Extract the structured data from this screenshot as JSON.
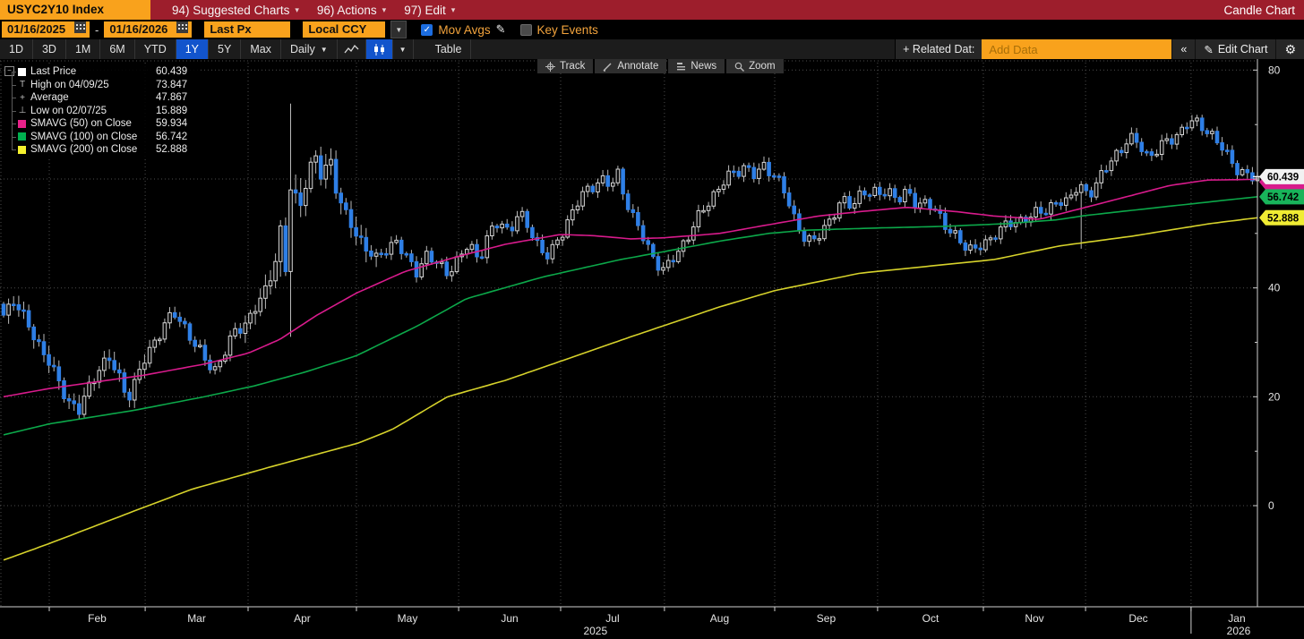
{
  "titlebar": {
    "ticker": "USYC2Y10 Index",
    "menus": [
      {
        "label": "94) Suggested Charts"
      },
      {
        "label": "96) Actions"
      },
      {
        "label": "97) Edit"
      }
    ],
    "right_title": "Candle Chart"
  },
  "controls": {
    "date_from": "01/16/2025",
    "date_sep": "-",
    "date_to": "01/16/2026",
    "price_field": "Last Px",
    "currency": "Local CCY",
    "mov_avgs_label": "Mov Avgs",
    "mov_avgs_checked": true,
    "key_events_label": "Key Events",
    "key_events_checked": false
  },
  "toolbar": {
    "ranges": [
      "1D",
      "3D",
      "1M",
      "6M",
      "YTD",
      "1Y",
      "5Y",
      "Max"
    ],
    "active_range": "1Y",
    "period": "Daily",
    "table_label": "Table",
    "related_data_label": "+ Related Dat:",
    "add_data_placeholder": "Add Data",
    "collapse_label": "«",
    "edit_chart_label": "Edit Chart"
  },
  "chart_tools": [
    "Track",
    "Annotate",
    "News",
    "Zoom"
  ],
  "legend": {
    "rows": [
      {
        "type": "candle",
        "label": "Last Price",
        "value": "60.439"
      },
      {
        "type": "high",
        "label": "High on 04/09/25",
        "value": "73.847"
      },
      {
        "type": "avg",
        "label": "Average",
        "value": "47.867"
      },
      {
        "type": "low",
        "label": "Low on 02/07/25",
        "value": "15.889"
      },
      {
        "type": "swatch",
        "color": "#e8218a",
        "label": "SMAVG (50) on Close",
        "value": "59.934"
      },
      {
        "type": "swatch",
        "color": "#00b04f",
        "label": "SMAVG (100) on Close",
        "value": "56.742"
      },
      {
        "type": "swatch",
        "color": "#f5f12e",
        "label": "SMAVG (200) on Close",
        "value": "52.888"
      }
    ]
  },
  "chart_data": {
    "type": "candlestick",
    "instrument": "USYC2Y10 Index",
    "date_range": [
      "01/16/2025",
      "01/16/2026"
    ],
    "last_price": 60.439,
    "average": 47.867,
    "high_marker": {
      "date": "04/09/25",
      "value": 73.847
    },
    "low_marker": {
      "date": "02/07/25",
      "value": 15.889
    },
    "y_axis": {
      "ticks": [
        0,
        20,
        40,
        60,
        80
      ],
      "minor_ticks": [
        10,
        30,
        50,
        70
      ]
    },
    "x_axis": {
      "month_labels": [
        "Feb",
        "Mar",
        "Apr",
        "May",
        "Jun",
        "Jul",
        "Aug",
        "Sep",
        "Oct",
        "Nov",
        "Dec",
        "Jan"
      ],
      "month_fracs": [
        0.0364,
        0.1129,
        0.195,
        0.2814,
        0.3629,
        0.4443,
        0.5271,
        0.615,
        0.6971,
        0.7814,
        0.8629,
        0.9471
      ],
      "year_labels": [
        {
          "label": "2025",
          "frac": 0.472
        },
        {
          "label": "2026",
          "frac": 0.985
        }
      ],
      "year_divider_frac": 0.9471
    },
    "num_candles": 250,
    "first_open": 37,
    "colors": {
      "up": "#d6d6d6",
      "down": "#2e7fe6",
      "wick": "#b9b9b9"
    },
    "smavg": [
      {
        "period": 50,
        "value": 59.934,
        "color": "#d81b8c",
        "points": [
          [
            0,
            20
          ],
          [
            0.036,
            21.5
          ],
          [
            0.113,
            24
          ],
          [
            0.16,
            26
          ],
          [
            0.195,
            28
          ],
          [
            0.22,
            30.5
          ],
          [
            0.25,
            35
          ],
          [
            0.281,
            39
          ],
          [
            0.32,
            43
          ],
          [
            0.363,
            45.8
          ],
          [
            0.4,
            48
          ],
          [
            0.444,
            49.8
          ],
          [
            0.47,
            49.6
          ],
          [
            0.5,
            49
          ],
          [
            0.527,
            49.2
          ],
          [
            0.571,
            50
          ],
          [
            0.615,
            51.8
          ],
          [
            0.65,
            53.2
          ],
          [
            0.683,
            54
          ],
          [
            0.72,
            54.8
          ],
          [
            0.76,
            54
          ],
          [
            0.79,
            53.2
          ],
          [
            0.826,
            52.6
          ],
          [
            0.863,
            54.8
          ],
          [
            0.9,
            57
          ],
          [
            0.93,
            58.8
          ],
          [
            0.96,
            59.8
          ],
          [
            1,
            59.934
          ]
        ]
      },
      {
        "period": 100,
        "value": 56.742,
        "color": "#0ca84a",
        "points": [
          [
            0,
            13
          ],
          [
            0.036,
            15
          ],
          [
            0.104,
            17.5
          ],
          [
            0.16,
            20
          ],
          [
            0.2,
            22
          ],
          [
            0.24,
            24.5
          ],
          [
            0.281,
            27.5
          ],
          [
            0.33,
            33
          ],
          [
            0.369,
            38
          ],
          [
            0.43,
            42
          ],
          [
            0.492,
            45.2
          ],
          [
            0.53,
            46.8
          ],
          [
            0.569,
            48.5
          ],
          [
            0.61,
            50
          ],
          [
            0.64,
            50.6
          ],
          [
            0.697,
            51
          ],
          [
            0.75,
            51.3
          ],
          [
            0.8,
            51.8
          ],
          [
            0.84,
            52.5
          ],
          [
            0.863,
            53.3
          ],
          [
            0.91,
            54.5
          ],
          [
            0.95,
            55.5
          ],
          [
            1,
            56.742
          ]
        ]
      },
      {
        "period": 200,
        "value": 52.888,
        "color": "#d6d22b",
        "points": [
          [
            0,
            -10
          ],
          [
            0.036,
            -7
          ],
          [
            0.104,
            -1
          ],
          [
            0.15,
            3
          ],
          [
            0.211,
            7
          ],
          [
            0.283,
            11.5
          ],
          [
            0.31,
            14
          ],
          [
            0.354,
            20
          ],
          [
            0.4,
            23
          ],
          [
            0.444,
            26.5
          ],
          [
            0.5,
            31
          ],
          [
            0.571,
            36.5
          ],
          [
            0.615,
            39.5
          ],
          [
            0.683,
            42.7
          ],
          [
            0.79,
            45.2
          ],
          [
            0.842,
            47.7
          ],
          [
            0.9,
            49.5
          ],
          [
            0.962,
            51.8
          ],
          [
            1,
            52.888
          ]
        ]
      }
    ],
    "close_path": [
      [
        0,
        35
      ],
      [
        0.008,
        37.5
      ],
      [
        0.016,
        34
      ],
      [
        0.024,
        31
      ],
      [
        0.036,
        27
      ],
      [
        0.044,
        23
      ],
      [
        0.052,
        19.5
      ],
      [
        0.0602,
        17.2
      ],
      [
        0.068,
        21
      ],
      [
        0.076,
        25
      ],
      [
        0.084,
        27
      ],
      [
        0.092,
        24
      ],
      [
        0.099,
        20.5
      ],
      [
        0.107,
        24
      ],
      [
        0.113,
        27
      ],
      [
        0.121,
        30
      ],
      [
        0.129,
        33
      ],
      [
        0.137,
        35
      ],
      [
        0.145,
        33
      ],
      [
        0.153,
        30
      ],
      [
        0.161,
        27
      ],
      [
        0.169,
        25
      ],
      [
        0.177,
        28
      ],
      [
        0.185,
        31.5
      ],
      [
        0.195,
        34
      ],
      [
        0.202,
        37
      ],
      [
        0.209,
        40
      ],
      [
        0.216,
        45
      ],
      [
        0.222,
        52
      ],
      [
        0.2263,
        43
      ],
      [
        0.2302,
        58
      ],
      [
        0.236,
        54
      ],
      [
        0.242,
        60
      ],
      [
        0.248,
        64
      ],
      [
        0.254,
        60
      ],
      [
        0.26,
        65
      ],
      [
        0.266,
        58
      ],
      [
        0.272,
        54
      ],
      [
        0.281,
        50
      ],
      [
        0.289,
        47
      ],
      [
        0.297,
        44.5
      ],
      [
        0.305,
        47
      ],
      [
        0.313,
        49
      ],
      [
        0.321,
        46
      ],
      [
        0.329,
        43.5
      ],
      [
        0.337,
        46
      ],
      [
        0.345,
        44
      ],
      [
        0.354,
        42.5
      ],
      [
        0.363,
        45
      ],
      [
        0.371,
        48.5
      ],
      [
        0.379,
        46
      ],
      [
        0.387,
        50
      ],
      [
        0.395,
        52
      ],
      [
        0.403,
        50
      ],
      [
        0.411,
        53
      ],
      [
        0.419,
        51
      ],
      [
        0.427,
        48
      ],
      [
        0.435,
        46
      ],
      [
        0.444,
        50
      ],
      [
        0.452,
        53
      ],
      [
        0.46,
        56
      ],
      [
        0.468,
        58
      ],
      [
        0.476,
        60
      ],
      [
        0.484,
        59
      ],
      [
        0.49,
        61.5
      ],
      [
        0.496,
        57
      ],
      [
        0.502,
        53
      ],
      [
        0.508,
        50
      ],
      [
        0.514,
        47
      ],
      [
        0.52,
        44.5
      ],
      [
        0.527,
        42.5
      ],
      [
        0.535,
        46
      ],
      [
        0.543,
        49
      ],
      [
        0.551,
        52
      ],
      [
        0.559,
        55
      ],
      [
        0.567,
        57
      ],
      [
        0.575,
        59
      ],
      [
        0.583,
        61
      ],
      [
        0.591,
        62.5
      ],
      [
        0.599,
        61
      ],
      [
        0.607,
        63
      ],
      [
        0.615,
        61
      ],
      [
        0.623,
        57
      ],
      [
        0.631,
        52
      ],
      [
        0.639,
        49
      ],
      [
        0.645,
        48
      ],
      [
        0.653,
        51
      ],
      [
        0.661,
        54
      ],
      [
        0.669,
        56
      ],
      [
        0.677,
        55
      ],
      [
        0.685,
        57.5
      ],
      [
        0.691,
        56.5
      ],
      [
        0.697,
        57
      ],
      [
        0.705,
        58.5
      ],
      [
        0.713,
        56.5
      ],
      [
        0.721,
        58
      ],
      [
        0.729,
        55.5
      ],
      [
        0.737,
        55
      ],
      [
        0.745,
        53
      ],
      [
        0.753,
        51
      ],
      [
        0.761,
        49
      ],
      [
        0.769,
        47.5
      ],
      [
        0.777,
        48.5
      ],
      [
        0.785,
        47.8
      ],
      [
        0.793,
        50
      ],
      [
        0.801,
        52
      ],
      [
        0.809,
        51
      ],
      [
        0.817,
        53.5
      ],
      [
        0.825,
        55
      ],
      [
        0.833,
        54
      ],
      [
        0.841,
        56.5
      ],
      [
        0.849,
        55.5
      ],
      [
        0.857,
        58
      ],
      [
        0.865,
        57
      ],
      [
        0.873,
        60
      ],
      [
        0.881,
        63
      ],
      [
        0.889,
        65.5
      ],
      [
        0.897,
        67.5
      ],
      [
        0.905,
        66
      ],
      [
        0.913,
        63.5
      ],
      [
        0.921,
        65.5
      ],
      [
        0.929,
        67
      ],
      [
        0.937,
        69
      ],
      [
        0.945,
        71
      ],
      [
        0.953,
        70
      ],
      [
        0.961,
        68.5
      ],
      [
        0.969,
        66
      ],
      [
        0.977,
        63.5
      ],
      [
        0.985,
        62
      ],
      [
        0.993,
        61
      ],
      [
        1,
        60.439
      ]
    ],
    "specials": [
      {
        "frac": 0.2289,
        "open": 43,
        "close": 58,
        "high": 73.847,
        "low": 31
      },
      {
        "frac": 0.0602,
        "low": 15.889
      },
      {
        "frac": 0.858,
        "low": 47.2
      }
    ]
  }
}
